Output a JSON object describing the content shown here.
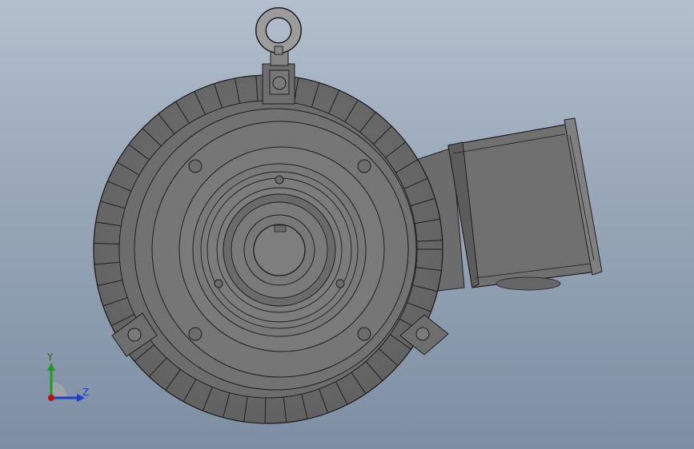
{
  "triad": {
    "x_label": "",
    "y_label": "Y",
    "z_label": "Z"
  },
  "colors": {
    "background_top": "#b3bfcc",
    "background_bottom": "#7d8fa4",
    "body_fill": "#6f6f6f",
    "edge": "#202020",
    "eyebolt_fill": "#9c9c9c",
    "axis_y": "#1f9a1f",
    "axis_z": "#1f3fbf",
    "axis_x": "#c01010"
  },
  "model": {
    "name": "motor-end-view",
    "component_icons": [
      "eyebolt-icon",
      "cooling-fin-icon",
      "terminal-box-icon",
      "shaft-icon",
      "keyway-icon",
      "mount-foot-icon"
    ]
  }
}
